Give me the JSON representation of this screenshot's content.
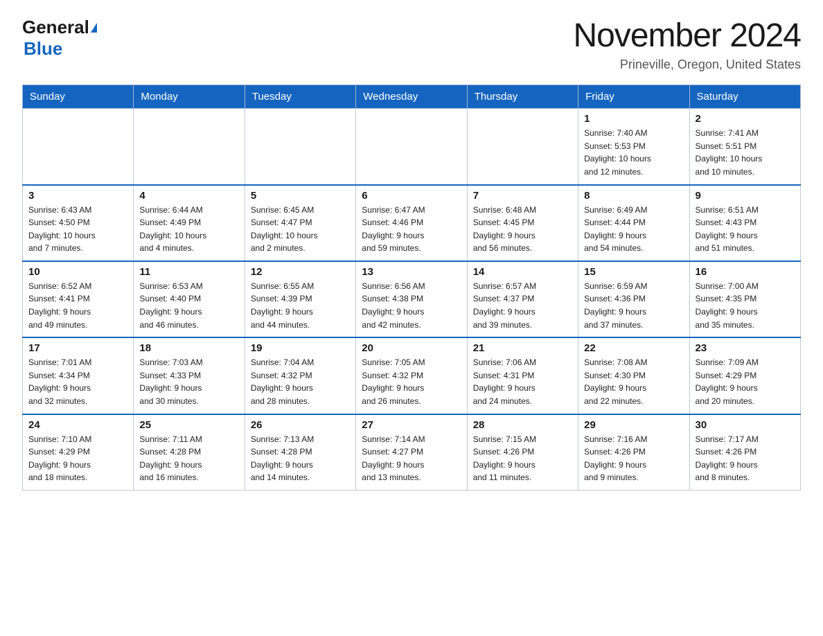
{
  "header": {
    "logo_general": "General",
    "logo_blue": "Blue",
    "month_title": "November 2024",
    "location": "Prineville, Oregon, United States"
  },
  "days_of_week": [
    "Sunday",
    "Monday",
    "Tuesday",
    "Wednesday",
    "Thursday",
    "Friday",
    "Saturday"
  ],
  "weeks": [
    [
      {
        "day": "",
        "info": ""
      },
      {
        "day": "",
        "info": ""
      },
      {
        "day": "",
        "info": ""
      },
      {
        "day": "",
        "info": ""
      },
      {
        "day": "",
        "info": ""
      },
      {
        "day": "1",
        "info": "Sunrise: 7:40 AM\nSunset: 5:53 PM\nDaylight: 10 hours\nand 12 minutes."
      },
      {
        "day": "2",
        "info": "Sunrise: 7:41 AM\nSunset: 5:51 PM\nDaylight: 10 hours\nand 10 minutes."
      }
    ],
    [
      {
        "day": "3",
        "info": "Sunrise: 6:43 AM\nSunset: 4:50 PM\nDaylight: 10 hours\nand 7 minutes."
      },
      {
        "day": "4",
        "info": "Sunrise: 6:44 AM\nSunset: 4:49 PM\nDaylight: 10 hours\nand 4 minutes."
      },
      {
        "day": "5",
        "info": "Sunrise: 6:45 AM\nSunset: 4:47 PM\nDaylight: 10 hours\nand 2 minutes."
      },
      {
        "day": "6",
        "info": "Sunrise: 6:47 AM\nSunset: 4:46 PM\nDaylight: 9 hours\nand 59 minutes."
      },
      {
        "day": "7",
        "info": "Sunrise: 6:48 AM\nSunset: 4:45 PM\nDaylight: 9 hours\nand 56 minutes."
      },
      {
        "day": "8",
        "info": "Sunrise: 6:49 AM\nSunset: 4:44 PM\nDaylight: 9 hours\nand 54 minutes."
      },
      {
        "day": "9",
        "info": "Sunrise: 6:51 AM\nSunset: 4:43 PM\nDaylight: 9 hours\nand 51 minutes."
      }
    ],
    [
      {
        "day": "10",
        "info": "Sunrise: 6:52 AM\nSunset: 4:41 PM\nDaylight: 9 hours\nand 49 minutes."
      },
      {
        "day": "11",
        "info": "Sunrise: 6:53 AM\nSunset: 4:40 PM\nDaylight: 9 hours\nand 46 minutes."
      },
      {
        "day": "12",
        "info": "Sunrise: 6:55 AM\nSunset: 4:39 PM\nDaylight: 9 hours\nand 44 minutes."
      },
      {
        "day": "13",
        "info": "Sunrise: 6:56 AM\nSunset: 4:38 PM\nDaylight: 9 hours\nand 42 minutes."
      },
      {
        "day": "14",
        "info": "Sunrise: 6:57 AM\nSunset: 4:37 PM\nDaylight: 9 hours\nand 39 minutes."
      },
      {
        "day": "15",
        "info": "Sunrise: 6:59 AM\nSunset: 4:36 PM\nDaylight: 9 hours\nand 37 minutes."
      },
      {
        "day": "16",
        "info": "Sunrise: 7:00 AM\nSunset: 4:35 PM\nDaylight: 9 hours\nand 35 minutes."
      }
    ],
    [
      {
        "day": "17",
        "info": "Sunrise: 7:01 AM\nSunset: 4:34 PM\nDaylight: 9 hours\nand 32 minutes."
      },
      {
        "day": "18",
        "info": "Sunrise: 7:03 AM\nSunset: 4:33 PM\nDaylight: 9 hours\nand 30 minutes."
      },
      {
        "day": "19",
        "info": "Sunrise: 7:04 AM\nSunset: 4:32 PM\nDaylight: 9 hours\nand 28 minutes."
      },
      {
        "day": "20",
        "info": "Sunrise: 7:05 AM\nSunset: 4:32 PM\nDaylight: 9 hours\nand 26 minutes."
      },
      {
        "day": "21",
        "info": "Sunrise: 7:06 AM\nSunset: 4:31 PM\nDaylight: 9 hours\nand 24 minutes."
      },
      {
        "day": "22",
        "info": "Sunrise: 7:08 AM\nSunset: 4:30 PM\nDaylight: 9 hours\nand 22 minutes."
      },
      {
        "day": "23",
        "info": "Sunrise: 7:09 AM\nSunset: 4:29 PM\nDaylight: 9 hours\nand 20 minutes."
      }
    ],
    [
      {
        "day": "24",
        "info": "Sunrise: 7:10 AM\nSunset: 4:29 PM\nDaylight: 9 hours\nand 18 minutes."
      },
      {
        "day": "25",
        "info": "Sunrise: 7:11 AM\nSunset: 4:28 PM\nDaylight: 9 hours\nand 16 minutes."
      },
      {
        "day": "26",
        "info": "Sunrise: 7:13 AM\nSunset: 4:28 PM\nDaylight: 9 hours\nand 14 minutes."
      },
      {
        "day": "27",
        "info": "Sunrise: 7:14 AM\nSunset: 4:27 PM\nDaylight: 9 hours\nand 13 minutes."
      },
      {
        "day": "28",
        "info": "Sunrise: 7:15 AM\nSunset: 4:26 PM\nDaylight: 9 hours\nand 11 minutes."
      },
      {
        "day": "29",
        "info": "Sunrise: 7:16 AM\nSunset: 4:26 PM\nDaylight: 9 hours\nand 9 minutes."
      },
      {
        "day": "30",
        "info": "Sunrise: 7:17 AM\nSunset: 4:26 PM\nDaylight: 9 hours\nand 8 minutes."
      }
    ]
  ]
}
